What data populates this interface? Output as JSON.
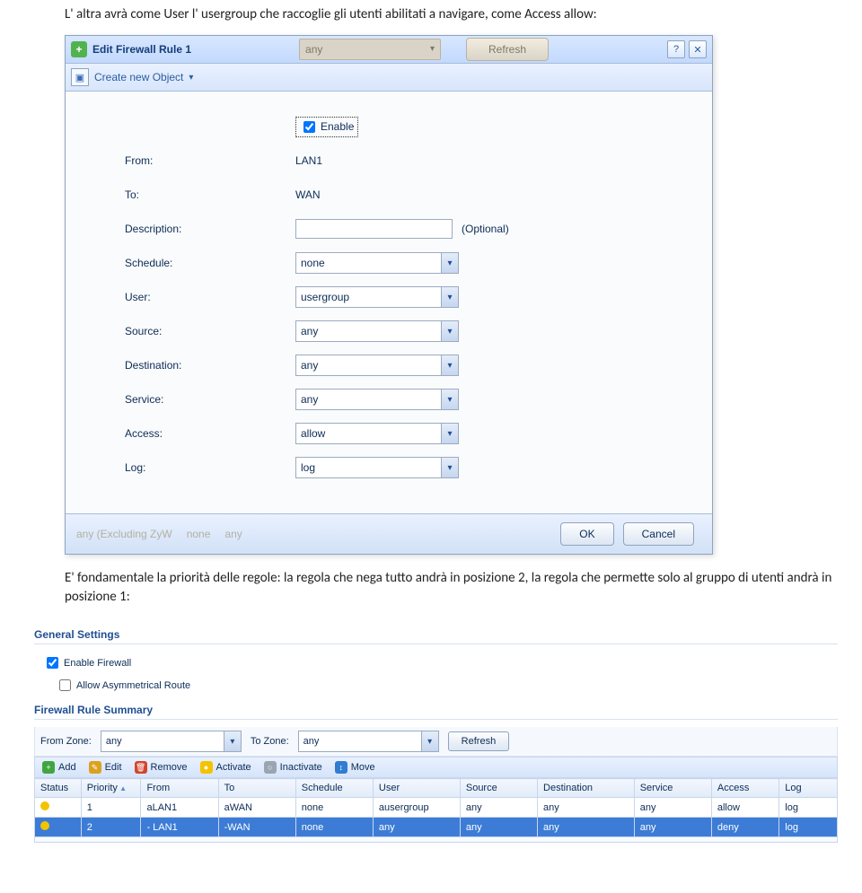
{
  "text": {
    "para1": "L' altra avrà come User l' usergroup che raccoglie gli utenti abilitati a navigare, come Access allow:",
    "para2": "E' fondamentale la priorità delle regole: la regola che nega tutto andrà in posizione 2, la regola che permette solo al gruppo di utenti andrà in posizione 1:"
  },
  "dialog": {
    "title": "Edit Firewall Rule 1",
    "faded_dd": "any",
    "faded_btn": "Refresh",
    "help": "?",
    "close": "✕",
    "create": "Create new Object",
    "enable": "Enable",
    "labels": {
      "from": "From:",
      "to": "To:",
      "desc": "Description:",
      "sched": "Schedule:",
      "user": "User:",
      "src": "Source:",
      "dst": "Destination:",
      "svc": "Service:",
      "acc": "Access:",
      "log": "Log:"
    },
    "values": {
      "from": "LAN1",
      "to": "WAN",
      "desc": "",
      "sched": "none",
      "user": "usergroup",
      "src": "any",
      "dst": "any",
      "svc": "any",
      "acc": "allow",
      "log": "log"
    },
    "optional": "(Optional)",
    "ghost": {
      "a": "any (Excluding ZyW",
      "b": "none",
      "c": "any"
    },
    "ok": "OK",
    "cancel": "Cancel"
  },
  "panel": {
    "hdr1": "General Settings",
    "enable_fw": "Enable Firewall",
    "asym": "Allow Asymmetrical Route",
    "hdr2": "Firewall Rule Summary",
    "from_zone": "From Zone:",
    "to_zone": "To Zone:",
    "any": "any",
    "refresh": "Refresh",
    "tb": {
      "add": "Add",
      "edit": "Edit",
      "remove": "Remove",
      "activate": "Activate",
      "inactivate": "Inactivate",
      "move": "Move"
    },
    "cols": {
      "status": "Status",
      "priority": "Priority",
      "from": "From",
      "to": "To",
      "schedule": "Schedule",
      "user": "User",
      "source": "Source",
      "destination": "Destination",
      "service": "Service",
      "access": "Access",
      "log": "Log"
    },
    "rows": [
      {
        "priority": "1",
        "from": "aLAN1",
        "to": "aWAN",
        "schedule": "none",
        "user": "ausergroup",
        "source": "any",
        "destination": "any",
        "service": "any",
        "access": "allow",
        "log": "log"
      },
      {
        "priority": "2",
        "from": "- LAN1",
        "to": "-WAN",
        "schedule": "none",
        "user": "any",
        "source": "any",
        "destination": "any",
        "service": "any",
        "access": "deny",
        "log": "log"
      }
    ]
  }
}
